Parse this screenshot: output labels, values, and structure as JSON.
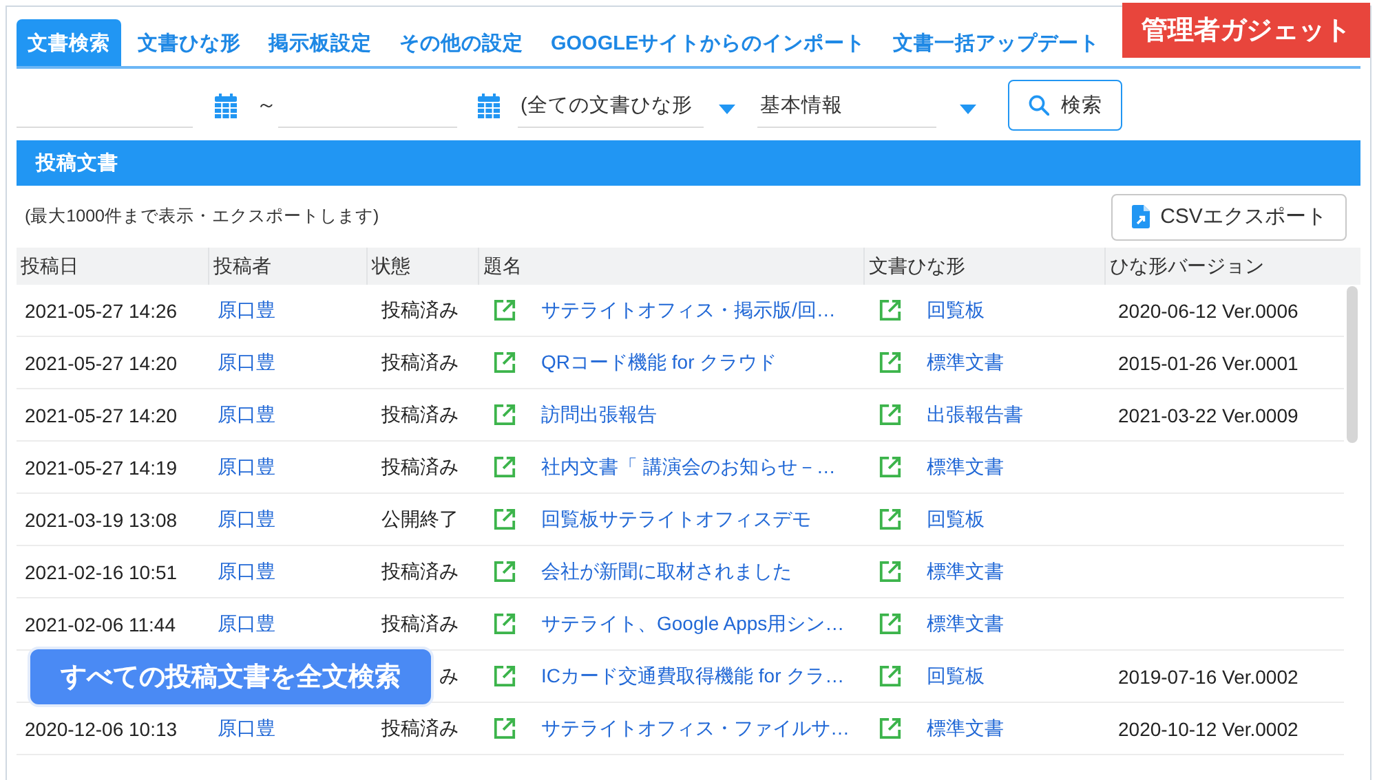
{
  "badge": {
    "label": "管理者ガジェット"
  },
  "tabs": [
    {
      "label": "文書検索",
      "selected": true
    },
    {
      "label": "文書ひな形",
      "selected": false
    },
    {
      "label": "掲示板設定",
      "selected": false
    },
    {
      "label": "その他の設定",
      "selected": false
    },
    {
      "label": "GOOGLEサイトからのインポート",
      "selected": false
    },
    {
      "label": "文書一括アップデート",
      "selected": false
    }
  ],
  "filters": {
    "date_separator": "～",
    "template_select": "(全ての文書ひな形",
    "field_select": "基本情報",
    "search_button": "検索"
  },
  "section": {
    "title": "投稿文書",
    "note": "(最大1000件まで表示・エクスポートします)",
    "export_button": "CSVエクスポート"
  },
  "table": {
    "columns": [
      "投稿日",
      "投稿者",
      "状態",
      "題名",
      "文書ひな形",
      "ひな形バージョン"
    ],
    "rows": [
      {
        "date": "2021-05-27 14:26",
        "author": "原口豊",
        "status": "投稿済み",
        "title": "サテライトオフィス・掲示版/回…",
        "template": "回覧板",
        "version": "2020-06-12 Ver.0006"
      },
      {
        "date": "2021-05-27 14:20",
        "author": "原口豊",
        "status": "投稿済み",
        "title": "QRコード機能 for クラウド",
        "template": "標準文書",
        "version": "2015-01-26 Ver.0001"
      },
      {
        "date": "2021-05-27 14:20",
        "author": "原口豊",
        "status": "投稿済み",
        "title": "訪問出張報告",
        "template": "出張報告書",
        "version": "2021-03-22 Ver.0009"
      },
      {
        "date": "2021-05-27 14:19",
        "author": "原口豊",
        "status": "投稿済み",
        "title": "社内文書「 講演会のお知らせ－…",
        "template": "標準文書"
      },
      {
        "date": "2021-03-19 13:08",
        "author": "原口豊",
        "status": "公開終了",
        "title": "回覧板サテライトオフィスデモ",
        "template": "回覧板"
      },
      {
        "date": "2021-02-16 10:51",
        "author": "原口豊",
        "status": "投稿済み",
        "title": "会社が新聞に取材されました",
        "template": "標準文書"
      },
      {
        "date": "2021-02-06 11:44",
        "author": "原口豊",
        "status": "投稿済み",
        "title": "サテライト、Google Apps用シン…",
        "template": "標準文書"
      },
      {
        "status": "み",
        "title": "ICカード交通費取得機能 for クラ…",
        "template": "回覧板",
        "version": "2019-07-16 Ver.0002"
      },
      {
        "date": "2020-12-06 10:13",
        "author": "原口豊",
        "status": "投稿済み",
        "title": "サテライトオフィス・ファイルサ…",
        "template": "標準文書",
        "version": "2020-10-12 Ver.0002"
      }
    ]
  },
  "floating_button": {
    "label": "すべての投稿文書を全文検索"
  }
}
